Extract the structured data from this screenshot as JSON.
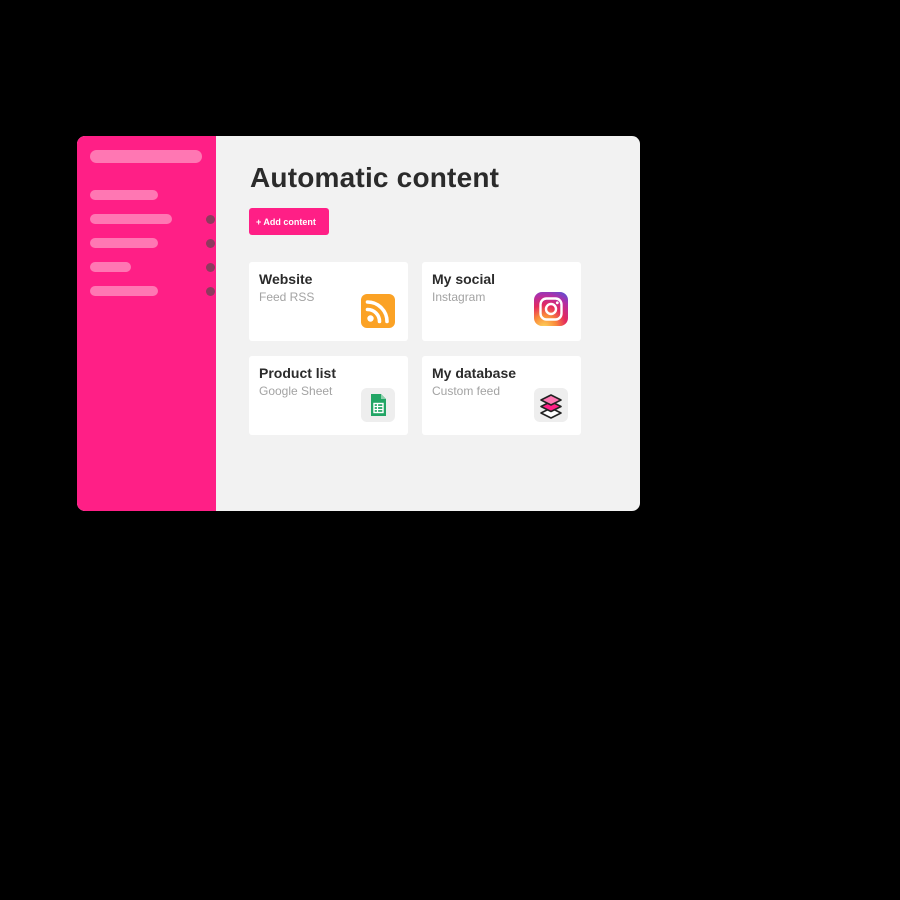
{
  "main": {
    "title": "Automatic content",
    "add_button_label": "+ Add content"
  },
  "sources": [
    {
      "title": "Website",
      "subtitle": "Feed RSS",
      "icon": "rss-icon"
    },
    {
      "title": "My social",
      "subtitle": "Instagram",
      "icon": "instagram-icon"
    },
    {
      "title": "Product list",
      "subtitle": "Google Sheet",
      "icon": "google-sheets-icon"
    },
    {
      "title": "My database",
      "subtitle": "Custom feed",
      "icon": "layers-icon"
    }
  ],
  "colors": {
    "accent": "#ff1f86",
    "sidebar_placeholder": "#ff77b3",
    "background": "#f2f2f2",
    "rss": "#fba225",
    "sheets": "#22a565"
  }
}
